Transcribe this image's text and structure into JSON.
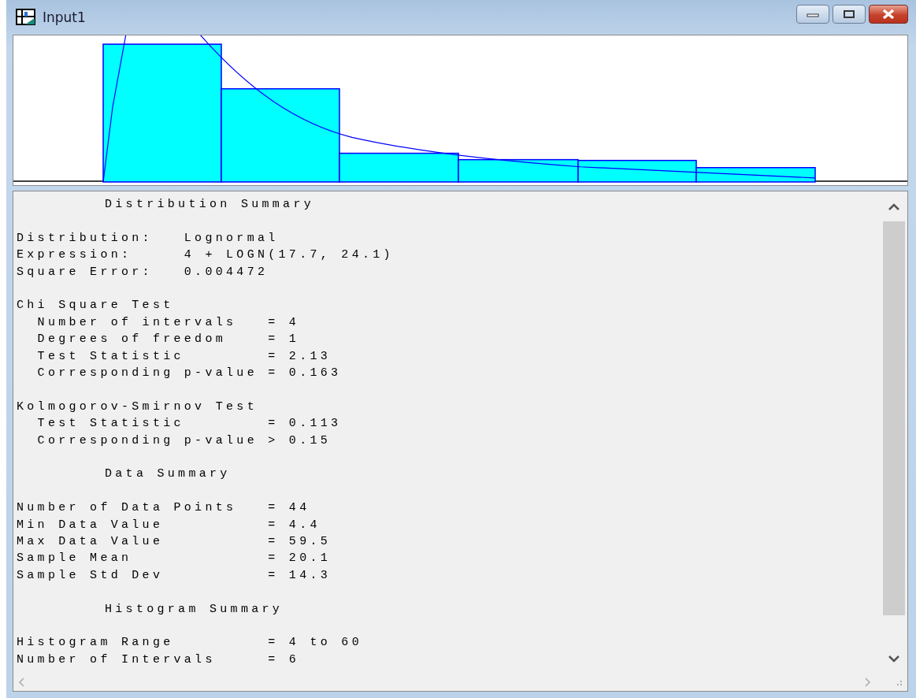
{
  "window": {
    "title": "Input1"
  },
  "report": [
    {
      "kind": "title",
      "lines": [
        "Distribution Summary"
      ]
    },
    {
      "kind": "lines",
      "lines": [
        "Distribution:   Lognormal",
        "Expression:     4 + LOGN(17.7, 24.1)",
        "Square Error:   0.004472"
      ]
    },
    {
      "kind": "lines",
      "lines": [
        "Chi Square Test",
        "  Number of intervals   = 4",
        "  Degrees of freedom    = 1",
        "  Test Statistic        = 2.13",
        "  Corresponding p-value = 0.163"
      ]
    },
    {
      "kind": "lines",
      "lines": [
        "Kolmogorov-Smirnov Test",
        "  Test Statistic        = 0.113",
        "  Corresponding p-value > 0.15"
      ]
    },
    {
      "kind": "title",
      "lines": [
        "Data Summary"
      ]
    },
    {
      "kind": "lines",
      "lines": [
        "Number of Data Points   = 44",
        "Min Data Value          = 4.4",
        "Max Data Value          = 59.5",
        "Sample Mean             = 20.1",
        "Sample Std Dev          = 14.3"
      ]
    },
    {
      "kind": "title",
      "lines": [
        "Histogram Summary"
      ]
    },
    {
      "kind": "lines",
      "lines": [
        "Histogram Range         = 4 to 60",
        "Number of Intervals     = 6"
      ]
    }
  ]
}
